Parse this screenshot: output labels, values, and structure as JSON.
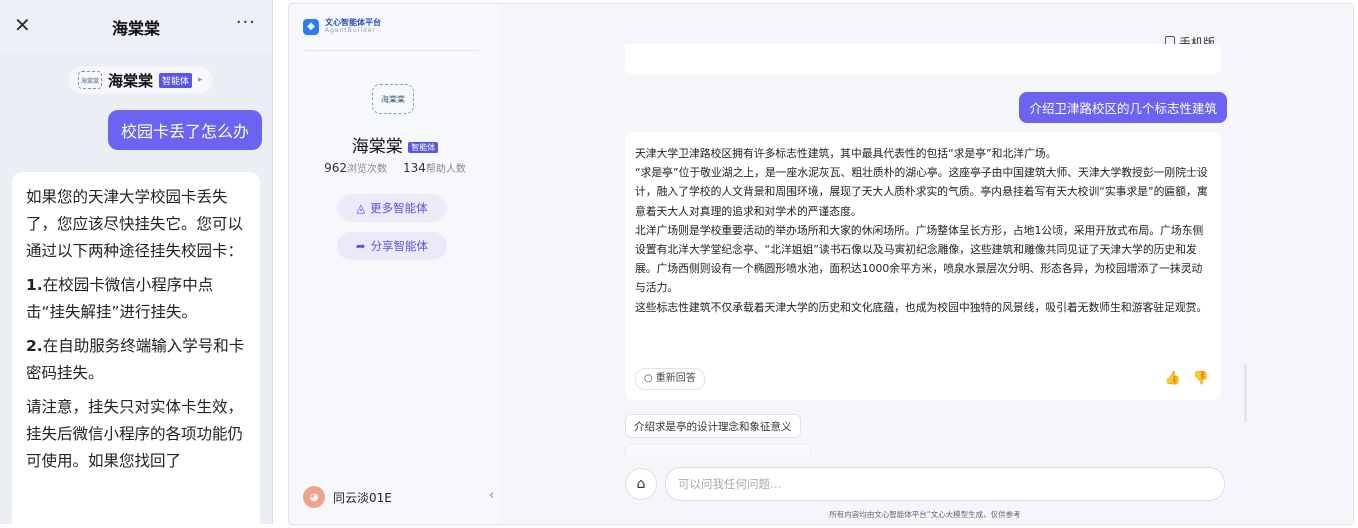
{
  "mobile": {
    "title": "海棠棠",
    "close_icon": "close-icon",
    "more_icon": "more-icon",
    "more_glyph": "···",
    "agent_pill": {
      "name": "海棠棠",
      "badge": "智能体",
      "arrow": "▸"
    },
    "user_message": "校园卡丢了怎么办",
    "answer": {
      "intro": "如果您的天津大学校园卡丢失了，您应该尽快挂失它。您可以通过以下两种途径挂失校园卡：",
      "item1_num": "1.",
      "item1": "在校园卡微信小程序中点击“挂失解挂”进行挂失。",
      "item2_num": "2.",
      "item2": "在自助服务终端输入学号和卡密码挂失。",
      "note": "请注意，挂失只对实体卡生效，挂失后微信小程序的各项功能仍可使用。如果您找回了"
    }
  },
  "desktop": {
    "brand": {
      "name": "文心智能体平台",
      "sub": "AgentBuilder"
    },
    "agent": {
      "name": "海棠棠",
      "badge": "智能体",
      "logo_text": "海棠棠"
    },
    "stats": {
      "views_count": "962",
      "views_label": "浏览次数",
      "helped_count": "134",
      "helped_label": "帮助人数"
    },
    "buttons": {
      "more_agents": "更多智能体",
      "share_agent": "分享智能体"
    },
    "user": {
      "name": "同云淡01E"
    },
    "collapse_glyph": "‹",
    "mobile_version": "手机版",
    "question": "介绍卫津路校区的几个标志性建筑",
    "answer": [
      "天津大学卫津路校区拥有许多标志性建筑，其中最具代表性的包括“求是亭”和北洋广场。",
      "“求是亭”位于敬业湖之上，是一座水泥灰瓦、粗壮质朴的湖心亭。这座亭子由中国建筑大师、天津大学教授彭一刚院士设计，融入了学校的人文背景和周围环境，展现了天大人质朴求实的气质。亭内悬挂着写有天大校训“实事求是”的匾额，寓意着天大人对真理的追求和对学术的严谨态度。",
      "北洋广场则是学校重要活动的举办场所和大家的休闲场所。广场整体呈长方形，占地1公顷，采用开放式布局。广场东侧设置有北洋大学堂纪念亭、“北洋姐姐”读书石像以及马寅初纪念雕像，这些建筑和雕像共同见证了天津大学的历史和发展。广场西侧则设有一个椭圆形喷水池，面积达1000余平方米，喷泉水景层次分明、形态各异，为校园增添了一抹灵动与活力。",
      "这些标志性建筑不仅承载着天津大学的历史和文化底蕴，也成为校园中独特的风景线，吸引着无数师生和游客驻足观赏。"
    ],
    "regenerate": "重新回答",
    "suggestion": "介绍求是亭的设计理念和象征意义",
    "input_placeholder": "可以问我任何问题…",
    "footer": "所有内容均由文心智能体平台“文心大模型生成，仅供参考"
  }
}
